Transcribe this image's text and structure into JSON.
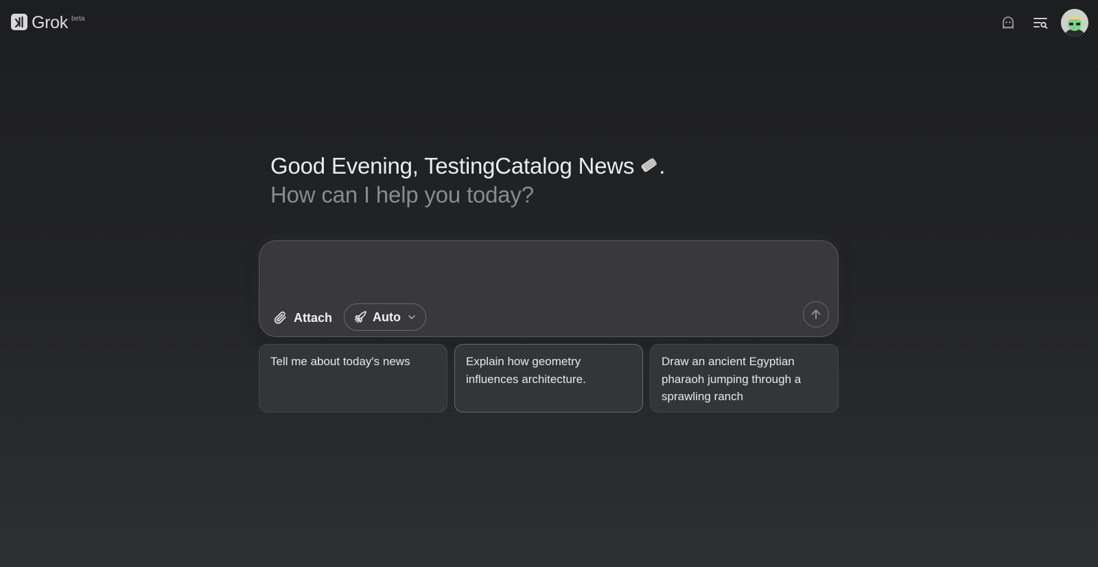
{
  "header": {
    "brand_name": "Grok",
    "brand_badge": "beta",
    "icons": [
      "ghost-icon",
      "history-search-icon"
    ],
    "avatar": "user-avatar"
  },
  "main": {
    "greeting": "Good Evening, TestingCatalog News",
    "greeting_punct": ".",
    "greeting_emoji": "newspaper-roll-icon",
    "subheading": "How can I help you today?"
  },
  "composer": {
    "input_value": "",
    "attach_label": "Attach",
    "model_label": "Auto",
    "icons": [
      "paperclip-icon",
      "rocket-icon",
      "chevron-down-icon",
      "arrow-up-icon"
    ]
  },
  "suggestions": [
    {
      "text": "Tell me about today's news"
    },
    {
      "text": "Explain how geometry influences architecture."
    },
    {
      "text": "Draw an ancient Egyptian pharaoh jumping through a sprawling ranch"
    }
  ],
  "colors": {
    "background_top": "#1d1e20",
    "background_bottom": "#2e2f31",
    "composer_bg": "#39393c",
    "card_bg": "#343538",
    "text_primary": "#ececec",
    "text_muted": "#8a8b8e"
  }
}
